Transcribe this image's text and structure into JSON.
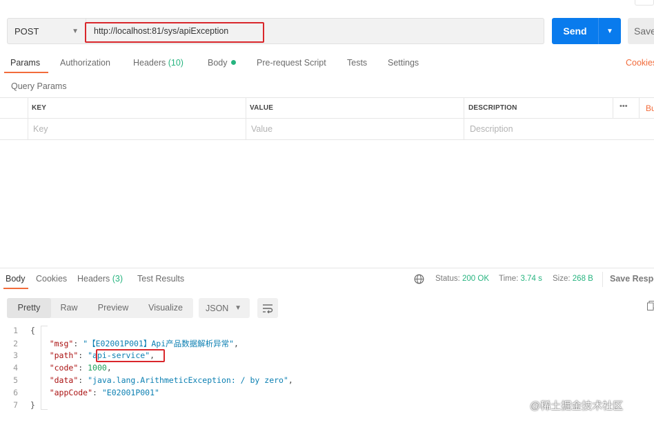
{
  "request": {
    "method": "POST",
    "url": "http://localhost:81/sys/apiException",
    "send_label": "Send",
    "save_label": "Save"
  },
  "request_tabs": {
    "params": "Params",
    "authorization": "Authorization",
    "headers": "Headers",
    "headers_count": "(10)",
    "body": "Body",
    "pre_request": "Pre-request Script",
    "tests": "Tests",
    "settings": "Settings",
    "cookies": "Cookies"
  },
  "params": {
    "section_label": "Query Params",
    "columns": [
      "KEY",
      "VALUE",
      "DESCRIPTION"
    ],
    "placeholders": [
      "Key",
      "Value",
      "Description"
    ],
    "more": "•••",
    "bulk_edit": "Bu"
  },
  "response": {
    "tabs": {
      "body": "Body",
      "cookies": "Cookies",
      "headers": "Headers",
      "headers_count": "(3)",
      "test_results": "Test Results"
    },
    "status_label": "Status:",
    "status_value": "200 OK",
    "time_label": "Time:",
    "time_value": "3.74 s",
    "size_label": "Size:",
    "size_value": "268 B",
    "save_response": "Save Respo",
    "views": [
      "Pretty",
      "Raw",
      "Preview",
      "Visualize"
    ],
    "format": "JSON",
    "code": {
      "line_numbers": [
        "1",
        "2",
        "3",
        "4",
        "5",
        "6",
        "7"
      ],
      "open": "{",
      "close": "}",
      "msg_key": "\"msg\"",
      "msg_val": "\"【E02001P001】Api产品数据解析异常\"",
      "path_key": "\"path\"",
      "path_val": "\"api-service\"",
      "code_key": "\"code\"",
      "code_val": "1000",
      "data_key": "\"data\"",
      "data_val": "\"java.lang.ArithmeticException: / by zero\"",
      "appcode_key": "\"appCode\"",
      "appcode_val": "\"E02001P001\""
    }
  },
  "watermark": "@稀土掘金技术社区",
  "colors": {
    "accent_orange": "#f26b3a",
    "send_blue": "#097bed",
    "status_green": "#26b47f",
    "highlight_red": "#d9262b"
  }
}
